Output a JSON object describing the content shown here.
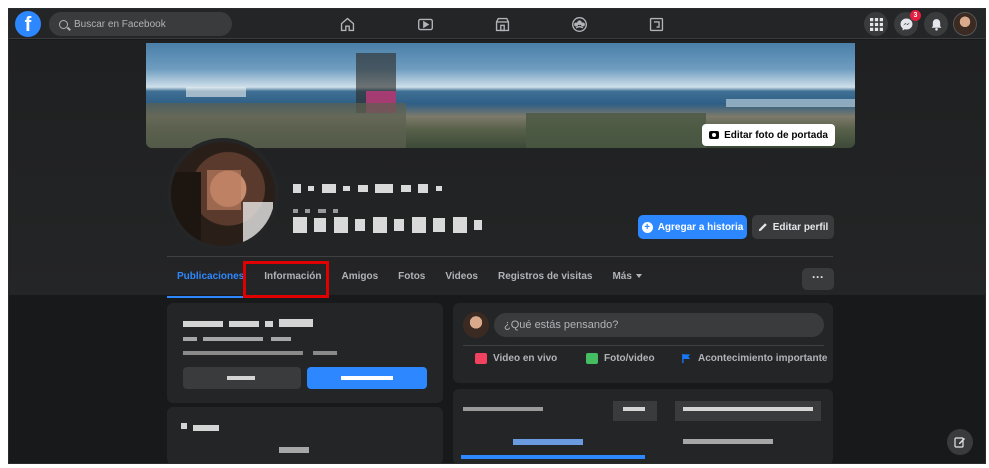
{
  "topbar": {
    "logo": "f",
    "search_placeholder": "Buscar en Facebook",
    "notification_count": "3"
  },
  "cover": {
    "edit_label": "Editar foto de portada"
  },
  "profile": {
    "add_story_label": "Agregar a historia",
    "edit_profile_label": "Editar perfil"
  },
  "tabs": [
    {
      "label": "Publicaciones",
      "active": true
    },
    {
      "label": "Información",
      "active": false
    },
    {
      "label": "Amigos",
      "active": false
    },
    {
      "label": "Fotos",
      "active": false
    },
    {
      "label": "Videos",
      "active": false
    },
    {
      "label": "Registros de visitas",
      "active": false
    },
    {
      "label": "Más",
      "active": false
    }
  ],
  "more_button_label": "···",
  "composer": {
    "placeholder": "¿Qué estás pensando?",
    "actions": [
      {
        "label": "Video en vivo",
        "icon": "live-video-icon",
        "color": "#f3425f"
      },
      {
        "label": "Foto/video",
        "icon": "photo-icon",
        "color": "#45bd62"
      },
      {
        "label": "Acontecimiento importante",
        "icon": "flag-icon",
        "color": "#1877f2"
      }
    ]
  },
  "colors": {
    "accent": "#2d88ff",
    "highlight": "#e10000",
    "background": "#18191a",
    "card": "#242526"
  }
}
